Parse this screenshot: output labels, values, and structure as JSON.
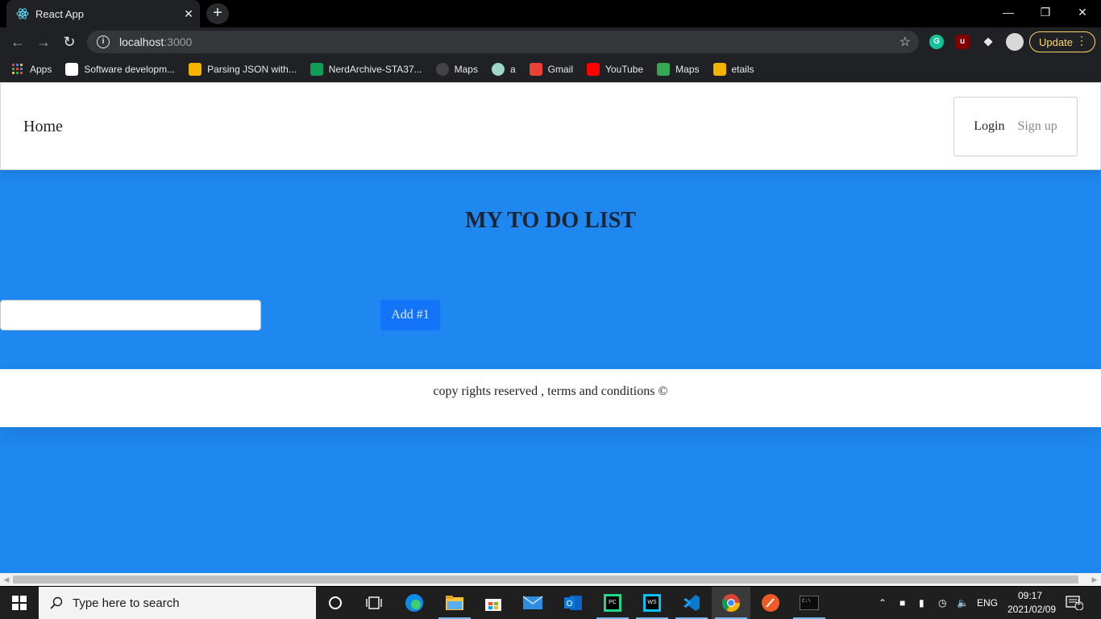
{
  "browser": {
    "tab_title": "React App",
    "tab_close": "✕",
    "new_tab": "+",
    "url_host": "localhost",
    "url_port": ":3000",
    "update_label": "Update",
    "window_controls": {
      "minimize": "—",
      "restore": "❐",
      "close": "✕"
    }
  },
  "bookmarks": [
    {
      "label": "Apps",
      "icon": "apps-grid-icon",
      "color": "#ea4335"
    },
    {
      "label": "Software developm...",
      "icon": "amazon-icon",
      "color": "#ffffff"
    },
    {
      "label": "Parsing JSON with...",
      "icon": "bookmark-site-icon",
      "color": "#f4b400"
    },
    {
      "label": "NerdArchive-STA37...",
      "icon": "google-drive-icon",
      "color": "#0f9d58"
    },
    {
      "label": "Maps",
      "icon": "github-icon",
      "color": "#444444"
    },
    {
      "label": "a",
      "icon": "circle-site-icon",
      "color": "#9ed6c8"
    },
    {
      "label": "Gmail",
      "icon": "gmail-icon",
      "color": "#ea4335"
    },
    {
      "label": "YouTube",
      "icon": "youtube-icon",
      "color": "#ff0000"
    },
    {
      "label": "Maps",
      "icon": "google-maps-icon",
      "color": "#34a853"
    },
    {
      "label": "etails",
      "icon": "share-site-icon",
      "color": "#f4b400"
    }
  ],
  "page": {
    "nav_home": "Home",
    "login": "Login",
    "signup": "Sign up",
    "heading": "MY TO DO LIST",
    "input_value": "",
    "add_button": "Add #1",
    "footer": "copy rights reserved , terms and conditions ©",
    "colors": {
      "background": "#1e88f0",
      "button": "#1474f7"
    }
  },
  "taskbar": {
    "search_placeholder": "Type here to search",
    "language": "ENG",
    "time": "09:17",
    "date": "2021/02/09",
    "notifications": "1",
    "apps": [
      "cortana-icon",
      "task-view-icon",
      "edge-icon",
      "file-explorer-icon",
      "store-icon",
      "mail-icon",
      "outlook-icon",
      "pycharm-icon",
      "webstorm-icon",
      "vscode-icon",
      "chrome-icon",
      "postman-icon",
      "terminal-icon"
    ]
  }
}
